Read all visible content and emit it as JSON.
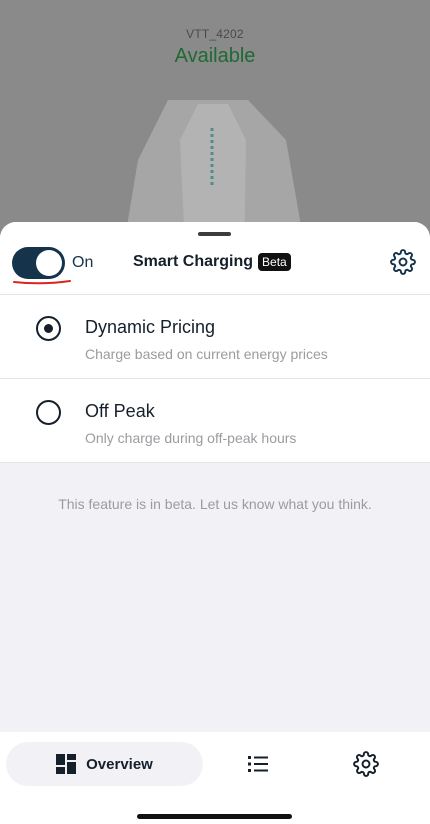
{
  "header": {
    "charger_id": "VTT_4202",
    "status": "Available"
  },
  "smart_charging": {
    "toggle_state_label": "On",
    "toggle_on": true,
    "title": "Smart Charging",
    "badge": "Beta"
  },
  "options": [
    {
      "title": "Dynamic Pricing",
      "subtitle": "Charge based on current energy prices",
      "selected": true
    },
    {
      "title": "Off Peak",
      "subtitle": "Only charge during off-peak hours",
      "selected": false
    }
  ],
  "beta_note": "This feature is in beta. Let us know what you think.",
  "bottom_nav": {
    "overview_label": "Overview",
    "items": [
      "grid-icon",
      "list-icon",
      "gear-icon"
    ]
  },
  "colors": {
    "status_green": "#1d6b33",
    "toggle_navy": "#15334b",
    "underline_red": "#d7261e"
  }
}
